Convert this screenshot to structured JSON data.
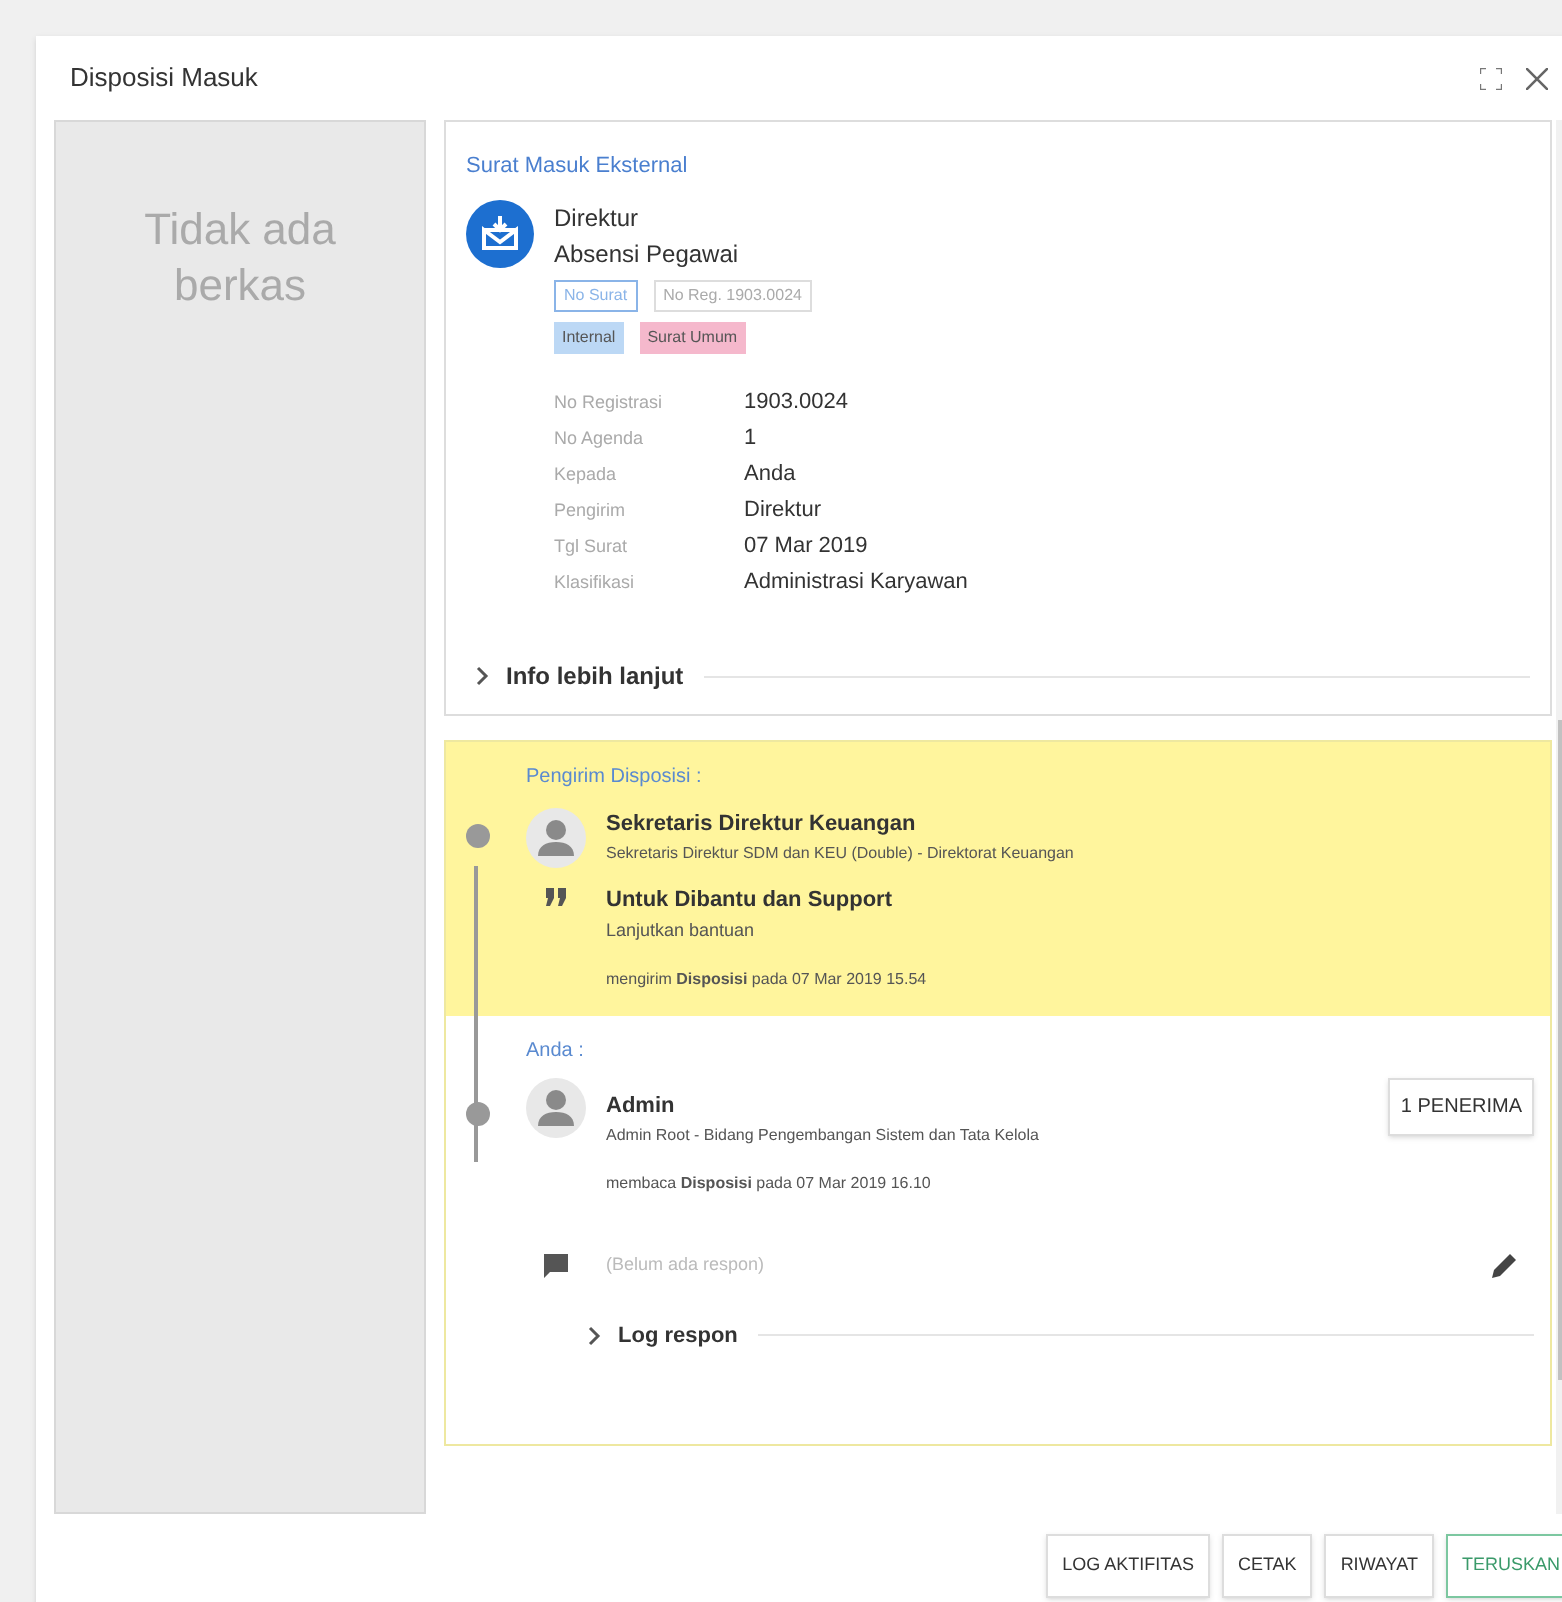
{
  "dialog": {
    "title": "Disposisi Masuk"
  },
  "files_panel": {
    "empty_text": "Tidak ada berkas"
  },
  "letter": {
    "category": "Surat Masuk Eksternal",
    "sender": "Direktur",
    "subject": "Absensi Pegawai",
    "chips": [
      "No Surat",
      "No Reg. 1903.0024"
    ],
    "tags": [
      {
        "label": "Internal",
        "color": "#bcd8f5"
      },
      {
        "label": "Surat Umum",
        "color": "#f5b8cc"
      }
    ],
    "fields": [
      {
        "label": "No Registrasi",
        "value": "1903.0024"
      },
      {
        "label": "No Agenda",
        "value": "1"
      },
      {
        "label": "Kepada",
        "value": "Anda"
      },
      {
        "label": "Pengirim",
        "value": "Direktur"
      },
      {
        "label": "Tgl Surat",
        "value": "07 Mar 2019"
      },
      {
        "label": "Klasifikasi",
        "value": "Administrasi Karyawan"
      }
    ],
    "more": {
      "label": "Info lebih lanjut",
      "expanded": false
    }
  },
  "sender_section": {
    "heading": "Pengirim Disposisi :",
    "name": "Sekretaris Direktur Keuangan",
    "role": "Sekretaris Direktur SDM dan KEU (Double) - Direktorat Keuangan",
    "instruction": "Untuk Dibantu dan Support",
    "note": "Lanjutkan bantuan",
    "activity": "mengirim **Disposisi** pada 07 Mar 2019 15.54"
  },
  "recipient_section": {
    "heading": "Anda :",
    "name": "Admin",
    "role": "Admin Root - Bidang Pengembangan Sistem dan Tata Kelola",
    "activity": "membaca **Disposisi** pada 07 Mar 2019 16.10",
    "recipients_button": "1 PENERIMA",
    "response_field": {
      "placeholder": "(Belum ada respon)"
    },
    "log": {
      "label": "Log respon",
      "expanded": false
    }
  },
  "buttons": [
    {
      "label": "LOG AKTIFITAS",
      "kind": "plain"
    },
    {
      "label": "CETAK",
      "kind": "plain"
    },
    {
      "label": "RIWAYAT",
      "kind": "plain"
    },
    {
      "label": "TERUSKAN",
      "kind": "primary"
    }
  ]
}
